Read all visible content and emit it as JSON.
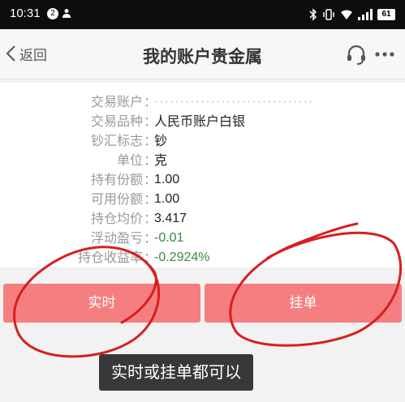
{
  "status_bar": {
    "time": "10:31",
    "notification_count": "2",
    "battery": "61"
  },
  "nav": {
    "back_label": "返回",
    "title": "我的账户贵金属"
  },
  "account_info": [
    {
      "label": "交易账户",
      "value": "·······························",
      "style": "masked"
    },
    {
      "label": "交易品种",
      "value": "人民币账户白银",
      "style": "cn"
    },
    {
      "label": "钞汇标志",
      "value": "钞",
      "style": "cn"
    },
    {
      "label": "单位",
      "value": "克",
      "style": "cn"
    },
    {
      "label": "持有份额",
      "value": "1.00",
      "style": ""
    },
    {
      "label": "可用份额",
      "value": "1.00",
      "style": ""
    },
    {
      "label": "持仓均价",
      "value": "3.417",
      "style": ""
    },
    {
      "label": "浮动盈亏",
      "value": "-0.01",
      "style": "green"
    },
    {
      "label": "持仓收益率",
      "value": "-0.2924%",
      "style": "green"
    }
  ],
  "buttons": {
    "realtime_label": "实时",
    "pending_label": "挂单"
  },
  "annotation": {
    "caption": "实时或挂单都可以",
    "circle_color": "#d81e1e"
  }
}
